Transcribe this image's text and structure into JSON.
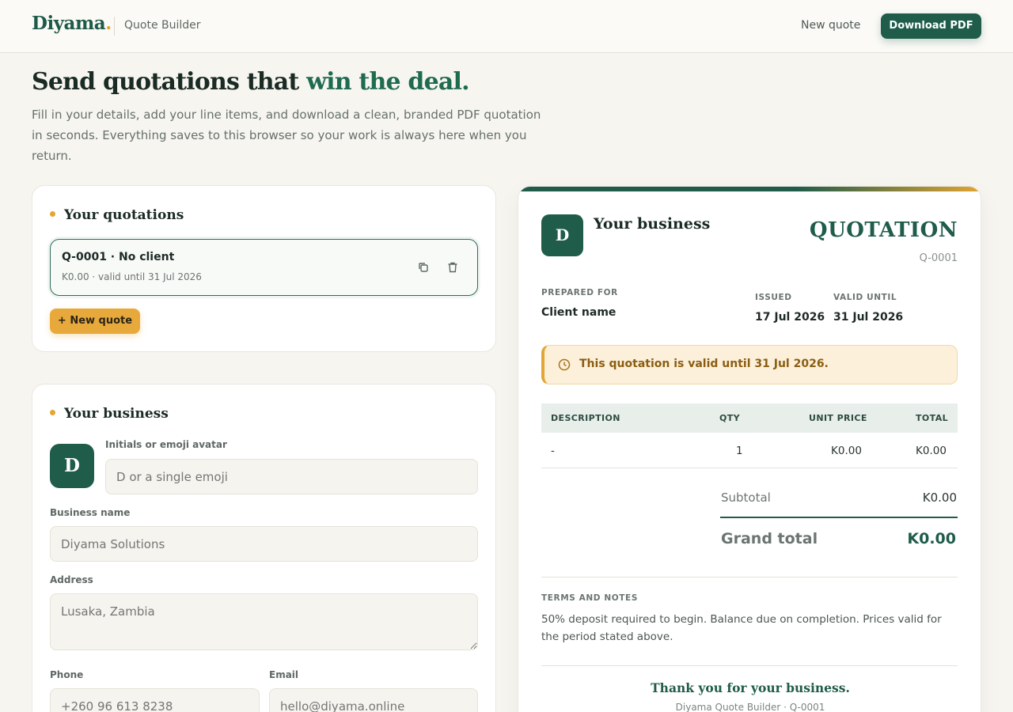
{
  "header": {
    "brand": "Diyama",
    "brand_dot": ".",
    "subtitle": "Quote Builder",
    "new_quote": "New quote",
    "download": "Download PDF"
  },
  "hero": {
    "title_start": "Send quotations that",
    "title_accent": "win the deal.",
    "description": "Fill in your details, add your line items, and download a clean, branded PDF quotation in seconds. Everything saves to this browser so your work is always here when you return."
  },
  "quotations": {
    "title": "Your quotations",
    "items": [
      {
        "title": "Q-0001 · No client",
        "subtitle": "K0.00 · valid until 31 Jul 2026"
      }
    ],
    "new_button": "+ New quote"
  },
  "business": {
    "title": "Your business",
    "avatar": "D",
    "avatar_label": "Initials or emoji avatar",
    "avatar_placeholder": "D or a single emoji",
    "name_label": "Business name",
    "name_placeholder": "Diyama Solutions",
    "address_label": "Address",
    "address_placeholder": "Lusaka, Zambia",
    "phone_label": "Phone",
    "phone_placeholder": "+260 96 613 8238",
    "email_label": "Email",
    "email_placeholder": "hello@diyama.online"
  },
  "preview": {
    "avatar": "D",
    "business_name": "Your business",
    "doc_title": "QUOTATION",
    "number": "Q-0001",
    "prepared_for_label": "PREPARED FOR",
    "client": "Client name",
    "issued_label": "ISSUED",
    "issued": "17 Jul 2026",
    "valid_label": "VALID UNTIL",
    "valid": "31 Jul 2026",
    "notice": "This quotation is valid until 31 Jul 2026.",
    "table": {
      "headers": [
        "DESCRIPTION",
        "QTY",
        "UNIT PRICE",
        "TOTAL"
      ],
      "rows": [
        {
          "description": "-",
          "qty": "1",
          "unit_price": "K0.00",
          "total": "K0.00"
        }
      ]
    },
    "subtotal_label": "Subtotal",
    "subtotal": "K0.00",
    "grand_total_label": "Grand total",
    "grand_total": "K0.00",
    "terms_label": "TERMS AND NOTES",
    "terms": "50% deposit required to begin. Balance due on completion. Prices valid for the period stated above.",
    "thanks": "Thank you for your business.",
    "footer": "Diyama Quote Builder · Q-0001"
  },
  "colors": {
    "primary": "#1f5c4a",
    "accent": "#e3a533",
    "background": "#f7f5f0"
  },
  "icons": [
    "copy-icon",
    "trash-icon",
    "clock-icon"
  ]
}
